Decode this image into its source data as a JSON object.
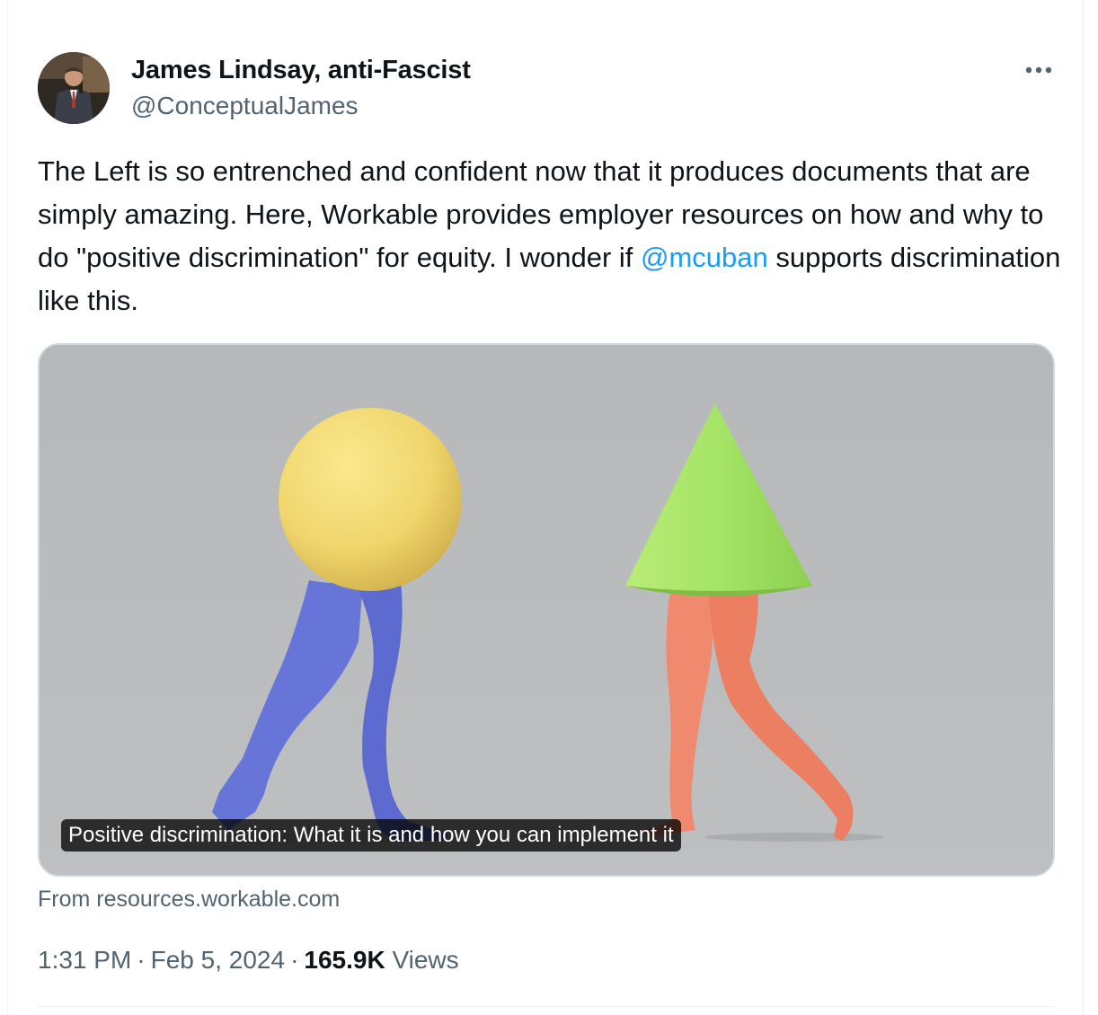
{
  "author": {
    "display_name": "James Lindsay, anti-Fascist",
    "handle": "@ConceptualJames"
  },
  "tweet": {
    "text_before_mention": "The Left is so entrenched and confident now that it produces documents that are simply amazing. Here, Workable provides employer resources on how and why to do \"positive discrimination\" for equity. I wonder if ",
    "mention": "@mcuban",
    "text_after_mention": " supports discrimination like this."
  },
  "card": {
    "title": "Positive discrimination: What it is and how you can implement it",
    "source": "From resources.workable.com",
    "image_description_icons": [
      "yellow-sphere-figure",
      "green-cone-figure"
    ],
    "background_color": "#b9bbbd"
  },
  "meta": {
    "time": "1:31 PM",
    "separator": "·",
    "date": "Feb 5, 2024",
    "views_count": "165.9K",
    "views_label": "Views"
  },
  "colors": {
    "link": "#1d9bf0",
    "secondary_text": "#536471",
    "primary_text": "#0f1419"
  },
  "icons": {
    "more": "more-horizontal-icon"
  }
}
